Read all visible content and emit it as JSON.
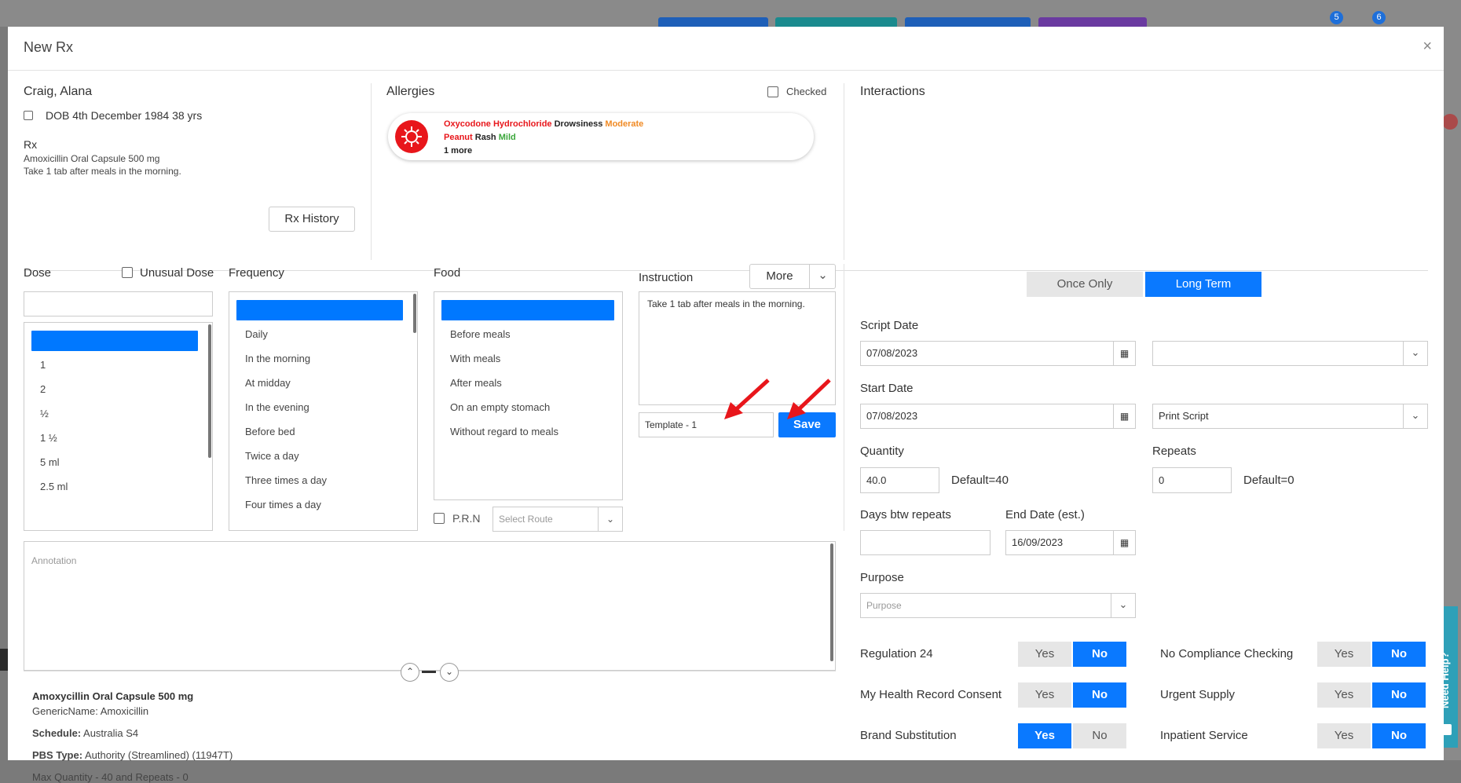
{
  "background_bar": {
    "badge_messages": "5",
    "badge_tasks": "6"
  },
  "modal": {
    "title": "New Rx",
    "close": "×"
  },
  "patient": {
    "name": "Craig, Alana",
    "dob": "DOB 4th December 1984 38 yrs",
    "rx_heading": "Rx",
    "rx_drug": "Amoxicillin Oral Capsule 500 mg",
    "rx_instruction": "Take 1 tab after meals in the morning.",
    "rx_history_label": "Rx History"
  },
  "allergies": {
    "heading": "Allergies",
    "checked_label": "Checked",
    "rows": [
      {
        "substance": "Oxycodone Hydrochloride",
        "reaction": "Drowsiness",
        "severity": "Moderate",
        "severity_color": "#f08a24"
      },
      {
        "substance": "Peanut",
        "reaction": "Rash",
        "severity": "Mild",
        "severity_color": "#3aa63a"
      }
    ],
    "more": "1 more"
  },
  "interactions": {
    "heading": "Interactions"
  },
  "dose": {
    "label": "Dose",
    "unusual_label": "Unusual Dose",
    "input_value": "",
    "items": [
      "1",
      "2",
      "½",
      "1 ½",
      "5 ml",
      "2.5 ml"
    ]
  },
  "frequency": {
    "label": "Frequency",
    "items": [
      "Daily",
      "In the morning",
      "At midday",
      "In the evening",
      "Before bed",
      "Twice a day",
      "Three times a day",
      "Four times a day"
    ]
  },
  "food": {
    "label": "Food",
    "items": [
      "Before meals",
      "With meals",
      "After meals",
      "On an empty stomach",
      "Without regard to meals"
    ],
    "prn_label": "P.R.N",
    "route_placeholder": "Select Route"
  },
  "instruction": {
    "label": "Instruction",
    "more_label": "More",
    "text": "Take 1 tab after meals in the morning.",
    "template_value": "Template - 1",
    "save_label": "Save"
  },
  "annotation": {
    "placeholder": "Annotation"
  },
  "drug_info": {
    "name": "Amoxycillin Oral Capsule 500 mg",
    "generic": "GenericName: Amoxicillin",
    "schedule_label": "Schedule:",
    "schedule_value": "Australia S4",
    "pbs_label": "PBS Type:",
    "pbs_value": "Authority (Streamlined) (11947T)",
    "max_qty": "Max Quantity - 40 and Repeats - 0"
  },
  "script": {
    "once_only": "Once Only",
    "long_term": "Long Term",
    "script_date_label": "Script Date",
    "script_date": "07/08/2023",
    "start_date_label": "Start Date",
    "start_date": "07/08/2023",
    "print_option": "Print Script",
    "quantity_label": "Quantity",
    "quantity": "40.0",
    "quantity_default": "Default=40",
    "repeats_label": "Repeats",
    "repeats": "0",
    "repeats_default": "Default=0",
    "days_btw_label": "Days btw repeats",
    "days_btw": "",
    "end_date_label": "End Date (est.)",
    "end_date": "16/09/2023",
    "purpose_label": "Purpose",
    "purpose_placeholder": "Purpose"
  },
  "toggles": {
    "yes": "Yes",
    "no": "No",
    "regulation24": "Regulation 24",
    "my_health_record": "My Health Record Consent",
    "brand_substitution": "Brand Substitution",
    "no_compliance": "No Compliance Checking",
    "urgent_supply": "Urgent Supply",
    "inpatient": "Inpatient Service"
  },
  "help": {
    "label": "Need Help?"
  },
  "colors": {
    "accent": "#0a79ff",
    "danger": "#e8161b"
  }
}
